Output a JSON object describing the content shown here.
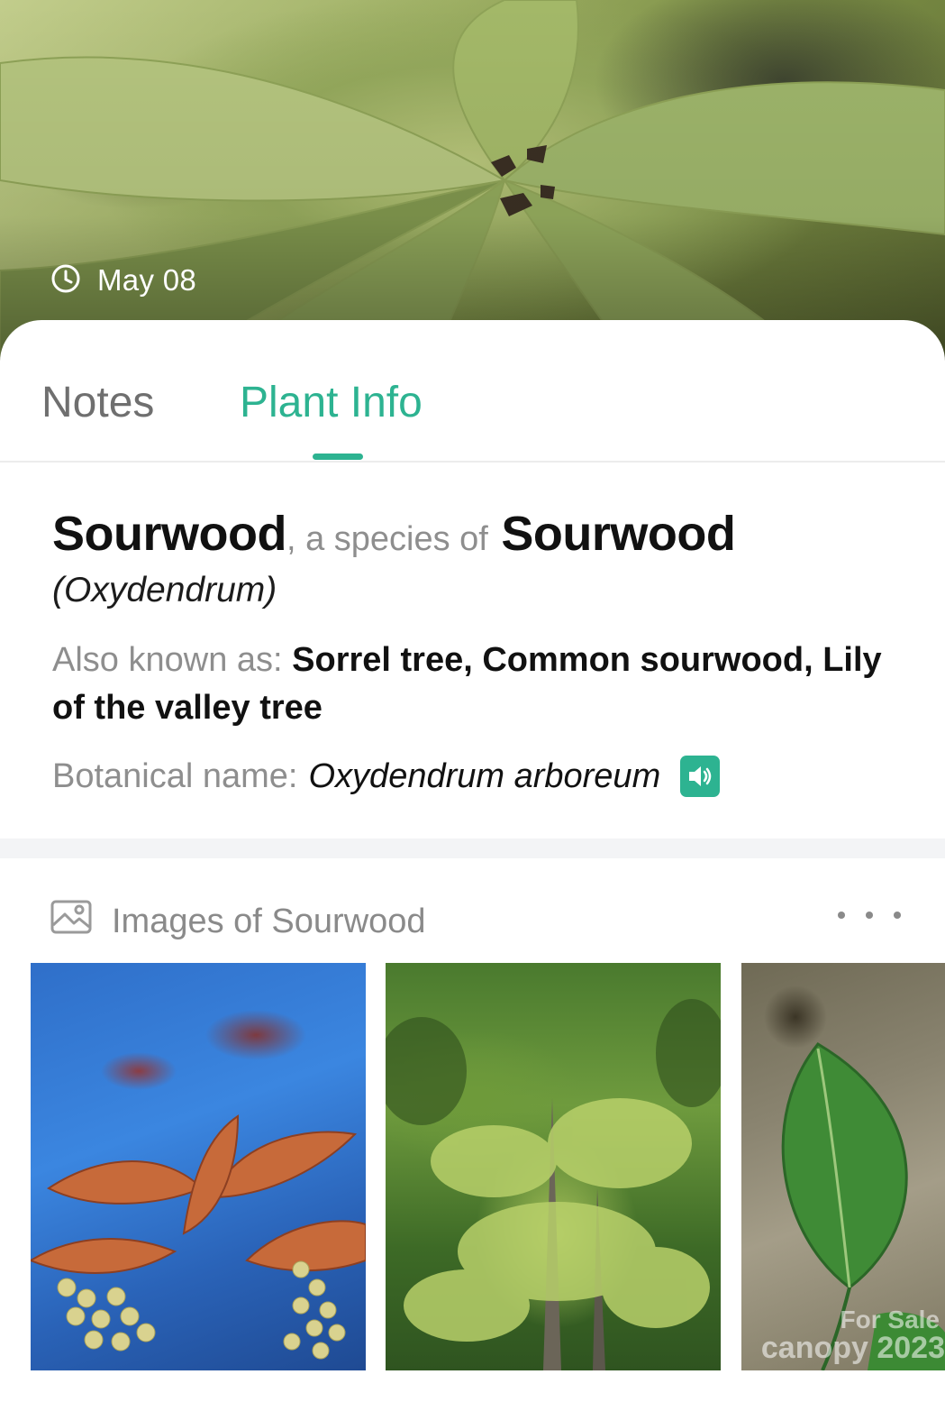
{
  "hero": {
    "date": "May 08",
    "icon": "clock-icon"
  },
  "tabs": [
    {
      "label": "Notes",
      "active": false
    },
    {
      "label": "Plant Info",
      "active": true
    }
  ],
  "plant": {
    "common_name": "Sourwood",
    "species_connector": ", a species of",
    "genus_common": "Sourwood",
    "genus_latin": "(Oxydendrum)",
    "aka_label": "Also known as:",
    "aka_value": "Sorrel tree, Common sourwood, Lily of the valley tree",
    "botanical_label": "Botanical name:",
    "botanical_value": "Oxydendrum arboreum",
    "audio_icon": "speaker-icon"
  },
  "images_section": {
    "title": "Images of Sourwood",
    "icon": "image-icon",
    "more_icon": "more-icon",
    "images": [
      {
        "subject": "sourwood-autumn-leaves-flowers"
      },
      {
        "subject": "sourwood-tree"
      },
      {
        "subject": "sourwood-leaf"
      }
    ],
    "watermark_line1": "For Sale",
    "watermark_line2": "canopy 2023"
  },
  "colors": {
    "accent": "#2db391",
    "muted_text": "#8e8e8e",
    "primary_text": "#111111",
    "divider": "#f3f4f6"
  }
}
